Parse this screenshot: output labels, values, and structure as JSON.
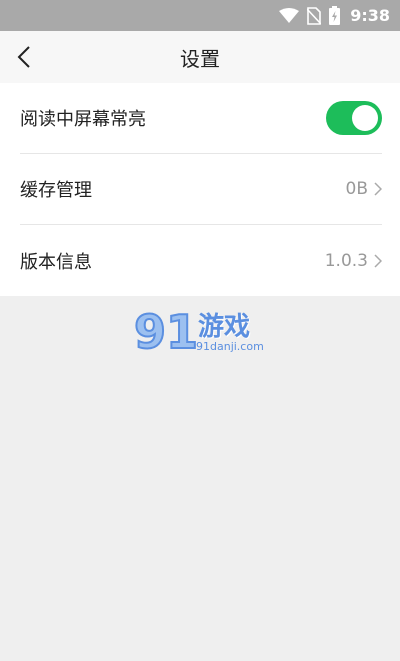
{
  "status_bar": {
    "time": "9:38",
    "icons": [
      "wifi-icon",
      "no-sim-icon",
      "battery-charging-icon"
    ]
  },
  "header": {
    "title": "设置",
    "back_icon": "chevron-left-icon"
  },
  "settings": {
    "items": [
      {
        "label": "阅读中屏幕常亮",
        "type": "toggle",
        "state": "on"
      },
      {
        "label": "缓存管理",
        "type": "value",
        "value": "0B"
      },
      {
        "label": "版本信息",
        "type": "value",
        "value": "1.0.3"
      }
    ]
  },
  "watermark": {
    "logo_text": "游戏",
    "logo_number": "91",
    "url": "91danji.com"
  },
  "colors": {
    "status_bar": "#a9a9a9",
    "toggle_on": "#1dbd5a",
    "background": "#efefef",
    "watermark": "#5b8fe0"
  }
}
